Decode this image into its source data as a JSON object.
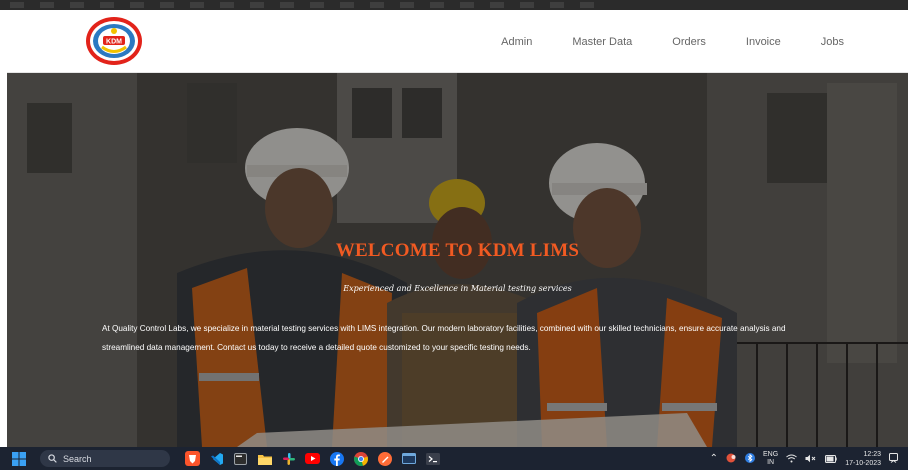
{
  "nav": {
    "items": [
      {
        "label": "Admin"
      },
      {
        "label": "Master Data"
      },
      {
        "label": "Orders"
      },
      {
        "label": "Invoice"
      },
      {
        "label": "Jobs"
      }
    ],
    "logo_text": "KDM"
  },
  "hero": {
    "title": "WELCOME TO KDM LIMS",
    "subtitle": "Experienced and Excellence in Material testing services",
    "description": "At Quality Control Labs, we specialize in material testing services with LIMS integration. Our modern laboratory facilities, combined with our skilled technicians, ensure accurate analysis and streamlined data management. Contact us today to receive a detailed quote customized to your specific testing needs."
  },
  "taskbar": {
    "search_placeholder": "Search",
    "language": "ENG",
    "region": "IN",
    "time": "12:23",
    "date": "17-10-2023"
  },
  "colors": {
    "accent": "#f15a22",
    "taskbar": "#1c2331"
  }
}
